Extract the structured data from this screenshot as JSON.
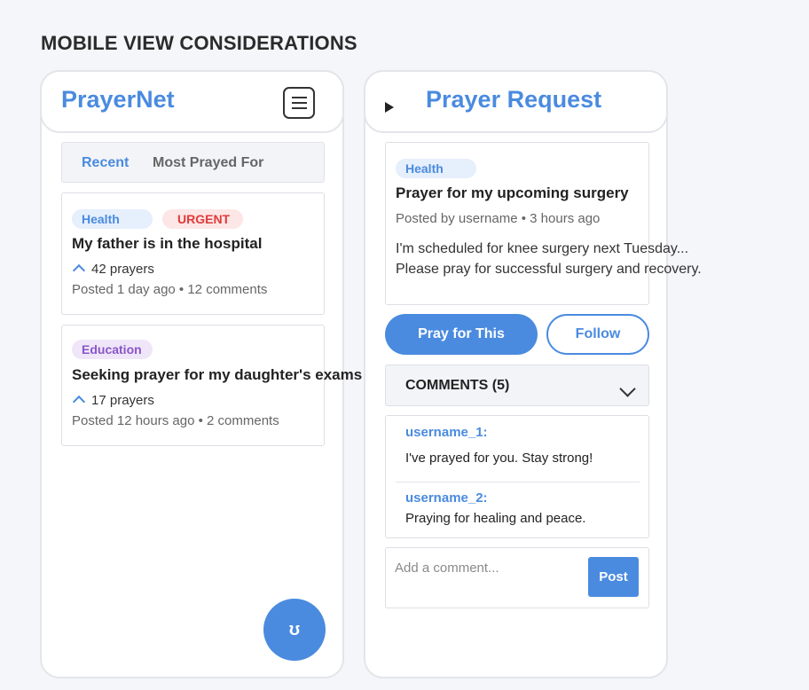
{
  "section_title": "MOBILE VIEW CONSIDERATIONS",
  "colors": {
    "accent": "#4a8bdf",
    "urgent": "#e03a3a",
    "education": "#8a55c8"
  },
  "left": {
    "brand": "PrayerNet",
    "menu_icon": "hamburger-menu-icon",
    "tabs": [
      "Recent",
      "Most Prayed For"
    ],
    "posts": [
      {
        "tags": [
          "Health",
          "URGENT"
        ],
        "title": "My father is in the hospital",
        "prayers": "42 prayers",
        "meta": "Posted 1 day ago • 12 comments"
      },
      {
        "tags": [
          "Education"
        ],
        "title": "Seeking prayer for my daughter's exams",
        "prayers": "17 prayers",
        "meta": "Posted 12 hours ago • 2 comments"
      }
    ],
    "fab_icon": "ʊ"
  },
  "right": {
    "title": "Prayer Request",
    "back_icon": "play-arrow-icon",
    "post": {
      "tag": "Health",
      "title": "Prayer for my upcoming surgery",
      "meta": "Posted by username • 3 hours ago",
      "body_line1": "I'm scheduled for knee surgery next Tuesday...",
      "body_line2": "Please pray for successful surgery and recovery."
    },
    "pray_button": "Pray for This",
    "follow_button": "Follow",
    "comments_label": "COMMENTS (5)",
    "comments": [
      {
        "user": "username_1:",
        "text": "I've prayed for you. Stay strong!"
      },
      {
        "user": "username_2:",
        "text": "Praying for healing and peace."
      }
    ],
    "comment_placeholder": "Add a comment...",
    "post_button": "Post"
  }
}
